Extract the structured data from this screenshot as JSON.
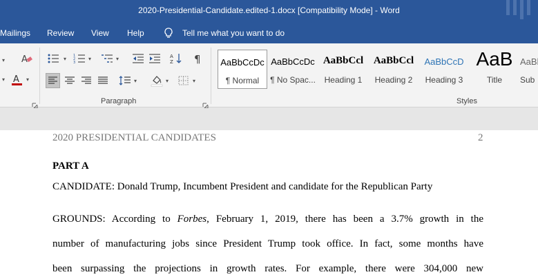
{
  "window": {
    "title": "2020-Presidential-Candidate.edited-1.docx [Compatibility Mode]  -  Word"
  },
  "tabs": [
    {
      "label": "Mailings"
    },
    {
      "label": "Review"
    },
    {
      "label": "View"
    },
    {
      "label": "Help"
    }
  ],
  "tell_me": {
    "label": "Tell me what you want to do",
    "icon": "lightbulb-icon"
  },
  "ribbon": {
    "paragraph_group_label": "Paragraph",
    "styles_group_label": "Styles",
    "styles": [
      {
        "preview": "AaBbCcDc",
        "name": "¶ Normal",
        "selected": true
      },
      {
        "preview": "AaBbCcDc",
        "name": "¶ No Spac..."
      },
      {
        "preview": "AaBbCcl",
        "name": "Heading 1"
      },
      {
        "preview": "AaBbCcl",
        "name": "Heading 2"
      },
      {
        "preview": "AaBbCcD",
        "name": "Heading 3"
      },
      {
        "preview": "AaB",
        "name": "Title"
      },
      {
        "preview": "AaBb",
        "name": "Sub"
      }
    ],
    "colors": {
      "heading3_blue": "#2e74b5",
      "font_color_red": "#c00000"
    }
  },
  "document": {
    "header_text": "2020 PRESIDENTIAL CANDIDATES",
    "page_number": "2",
    "part_heading": "PART A",
    "candidate_line": "CANDIDATE: Donald Trump, Incumbent President and candidate for the Republican Party",
    "grounds": {
      "line1_before": "GROUNDS: According to ",
      "line1_italic": "Forbes",
      "line1_after": ", February 1, 2019, there has been a 3.7% growth in the",
      "line2": "number of manufacturing jobs since President Trump took office. In fact, some months have",
      "line3": "been surpassing the projections in growth rates. For example, there were 304,000 new"
    }
  },
  "theme": {
    "brand_blue": "#2b579a"
  }
}
